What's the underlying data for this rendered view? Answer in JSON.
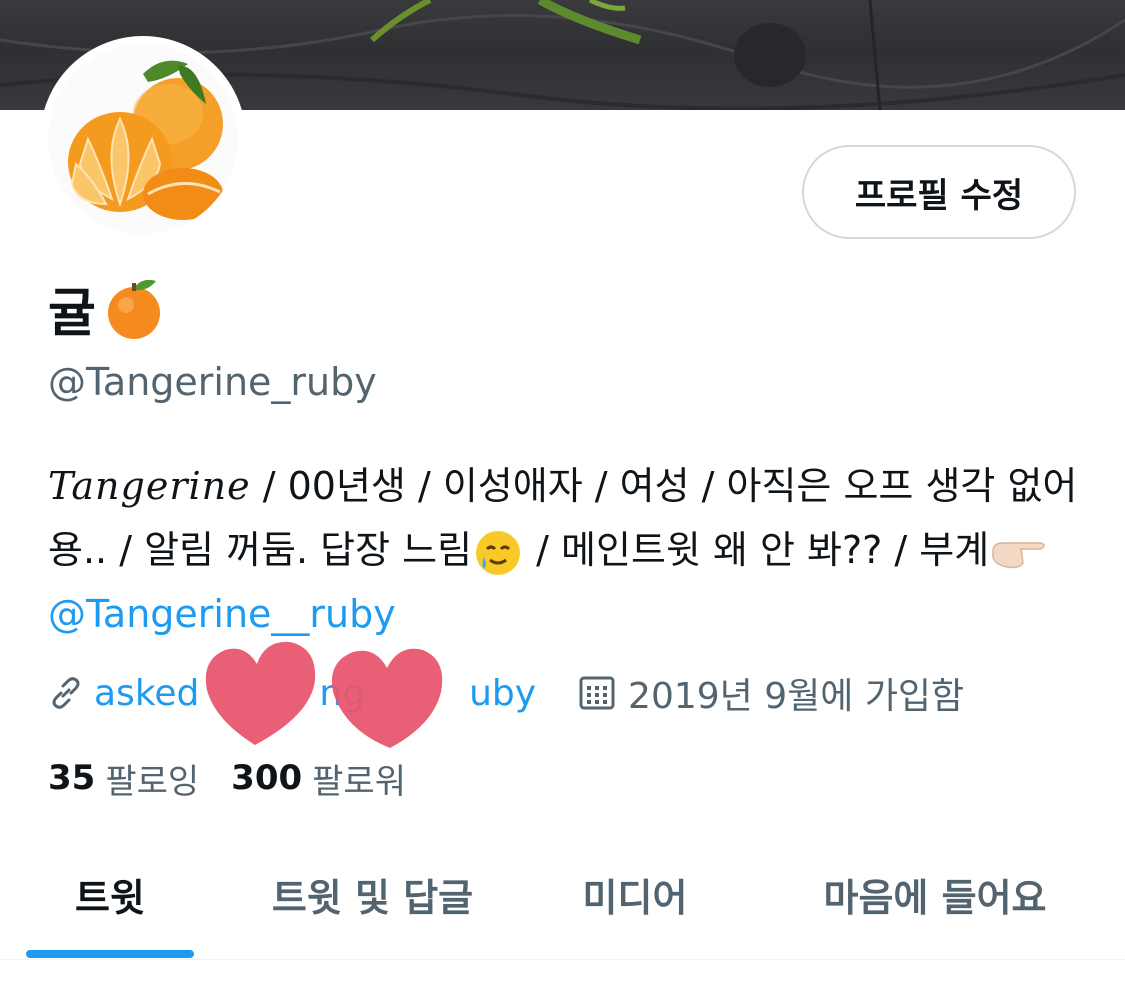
{
  "profile": {
    "edit_button": "프로필 수정",
    "display_name": "귤",
    "name_emoji": "tangerine-emoji",
    "handle": "@Tangerine_ruby",
    "avatar_icon": "tangerine-photo"
  },
  "bio": {
    "script_word": "Tangerine",
    "text_1": " / 00년생 / 이성애자 / 여성 / 아직은 오프 생각 없어용.. / 알림 꺼둠. 답장 느림",
    "text_2": " / 메인트윗 왜 안 봐?? / 부계",
    "mention": "@Tangerine__ruby",
    "emoji_1": "smiling-face-with-tear-emoji",
    "emoji_2": "pointing-right-emoji"
  },
  "meta": {
    "link_prefix": "asked",
    "link_middle": "ng",
    "link_suffix": "uby",
    "joined": "2019년 9월에 가입함",
    "link_icon": "link-icon",
    "calendar_icon": "calendar-icon"
  },
  "stats": {
    "following_count": "35",
    "following_label": "팔로잉",
    "followers_count": "300",
    "followers_label": "팔로워"
  },
  "tabs": [
    {
      "label": "트윗",
      "active": true
    },
    {
      "label": "트윗 및 답글",
      "active": false
    },
    {
      "label": "미디어",
      "active": false
    },
    {
      "label": "마음에 들어요",
      "active": false
    }
  ],
  "colors": {
    "accent": "#1d9bf0",
    "text_primary": "#0f1419",
    "text_secondary": "#536471",
    "heart": "#e8566f"
  }
}
